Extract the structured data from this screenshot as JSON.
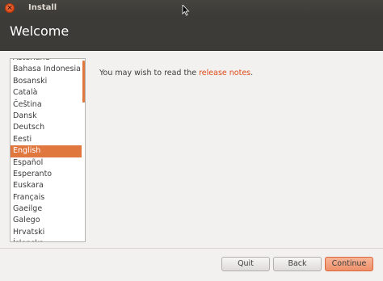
{
  "window": {
    "title": "Install",
    "close_glyph": "×"
  },
  "header": {
    "title": "Welcome"
  },
  "language_list": {
    "items": [
      "Asturianu",
      "Bahasa Indonesia",
      "Bosanski",
      "Català",
      "Čeština",
      "Dansk",
      "Deutsch",
      "Eesti",
      "English",
      "Español",
      "Esperanto",
      "Euskara",
      "Français",
      "Gaeilge",
      "Galego",
      "Hrvatski",
      "Íslenska"
    ],
    "selected": "English"
  },
  "content": {
    "message_prefix": "You may wish to read the ",
    "link_text": "release notes",
    "message_suffix": "."
  },
  "buttons": {
    "quit": "Quit",
    "back": "Back",
    "continue": "Continue"
  },
  "colors": {
    "accent": "#e0773f",
    "link": "#dd4814",
    "header_bg": "#3c3b37",
    "window_bg": "#f2f1f0"
  },
  "icons": {
    "close": "close-icon",
    "pointer": "mouse-pointer-icon"
  }
}
